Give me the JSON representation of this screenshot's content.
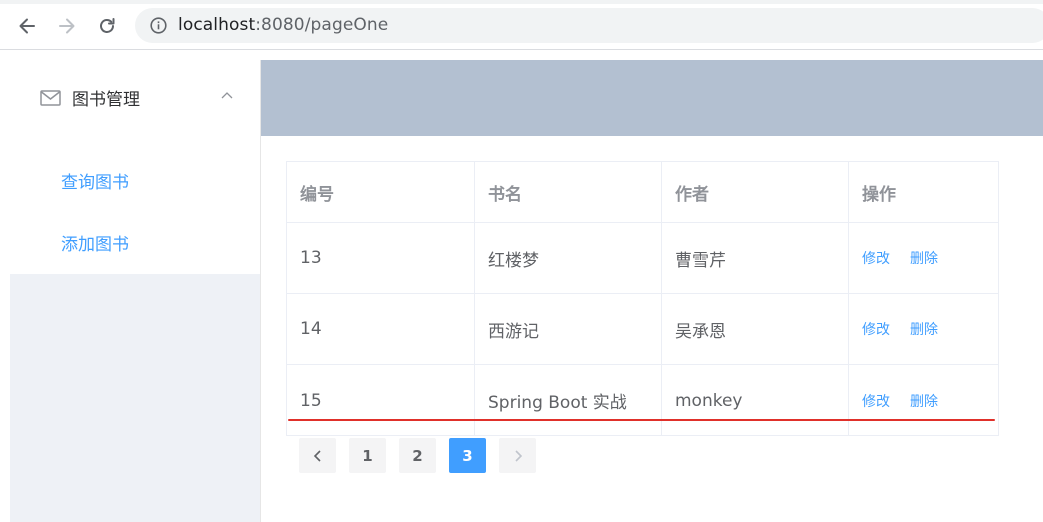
{
  "browser": {
    "url_host": "localhost",
    "url_rest": ":8080/pageOne"
  },
  "sidebar": {
    "submenu_title": "图书管理",
    "items": [
      {
        "label": "查询图书"
      },
      {
        "label": "添加图书"
      }
    ]
  },
  "table": {
    "headers": [
      "编号",
      "书名",
      "作者",
      "操作"
    ],
    "rows": [
      {
        "id": "13",
        "name": "红楼梦",
        "author": "曹雪芹"
      },
      {
        "id": "14",
        "name": "西游记",
        "author": "吴承恩"
      },
      {
        "id": "15",
        "name": "Spring Boot 实战",
        "author": "monkey"
      }
    ],
    "edit_label": "修改",
    "delete_label": "删除"
  },
  "pagination": {
    "pages": [
      "1",
      "2",
      "3"
    ],
    "current": "3"
  },
  "colors": {
    "accent": "#409eff",
    "header_band": "#b3c0d1",
    "highlight_line": "#e0302a"
  }
}
